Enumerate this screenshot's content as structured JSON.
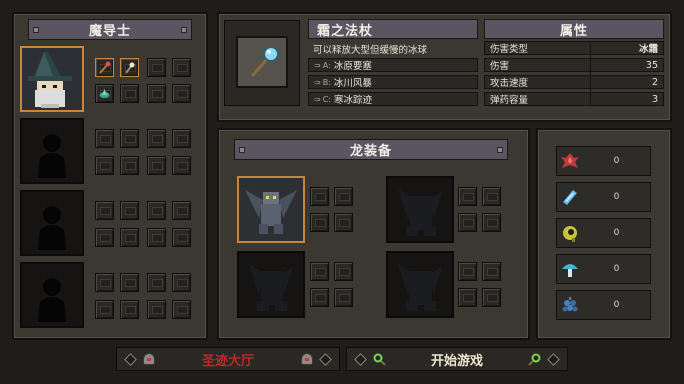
{
  "hero_panel": {
    "title": "魔导士"
  },
  "weapon": {
    "name": "霜之法杖",
    "description": "可以释放大型但缓慢的冰球",
    "skills": [
      {
        "key": "A",
        "name": "冰原要塞"
      },
      {
        "key": "B",
        "name": "冰川风暴"
      },
      {
        "key": "C",
        "name": "寒冰踪迹"
      }
    ]
  },
  "attributes": {
    "title": "属性",
    "rows": [
      {
        "label": "伤害类型",
        "value": "冰霜"
      },
      {
        "label": "伤害",
        "value": "35"
      },
      {
        "label": "攻击速度",
        "value": "2"
      },
      {
        "label": "弹药容量",
        "value": "3"
      }
    ]
  },
  "dragon_panel": {
    "title": "龙装备"
  },
  "resources": [
    {
      "icon": "red-crystal-icon",
      "value": "0",
      "color": "#c23a3a"
    },
    {
      "icon": "blue-crystal-icon",
      "value": "0",
      "color": "#5bb8e8"
    },
    {
      "icon": "eye-orb-icon",
      "value": "0",
      "color": "#c9c23a"
    },
    {
      "icon": "blue-mushroom-icon",
      "value": "0",
      "color": "#4ab0d4"
    },
    {
      "icon": "berry-cluster-icon",
      "value": "0",
      "color": "#4a7fc0"
    }
  ],
  "buttons": {
    "hall": "圣迹大厅",
    "start": "开始游戏"
  },
  "colors": {
    "accent_orange": "#c8853c",
    "hall_red": "#b92a2a",
    "start_text": "#ede6cf"
  }
}
